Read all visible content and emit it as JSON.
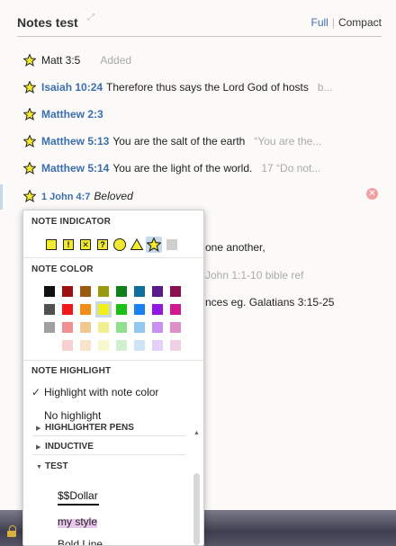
{
  "header": {
    "title": "Notes test",
    "view_full": "Full",
    "view_separator": "|",
    "view_compact": "Compact"
  },
  "notes": [
    {
      "ref": "Matt 3:5",
      "text": "",
      "extra": "Added"
    },
    {
      "ref": "Isaiah 10:24",
      "text": "Therefore thus says the Lord God of hosts",
      "extra": "b..."
    },
    {
      "ref": "Matthew 2:3",
      "text": "",
      "extra": ""
    },
    {
      "ref": "Matthew 5:13",
      "text": "You are the salt of the earth",
      "extra": "“You are the..."
    },
    {
      "ref": "Matthew 5:14",
      "text": "You are the light of the world.",
      "extra": "17 “Do not..."
    },
    {
      "ref": "1 John 4:7",
      "text": "Beloved",
      "extra": ""
    }
  ],
  "background_lines": [
    "one another,",
    "John 1:1-10 bible ref",
    "nces  eg.  Galatians 3:15-25"
  ],
  "popup": {
    "indicator_heading": "NOTE INDICATOR",
    "indicator_marks": [
      "!",
      "✕",
      "?"
    ],
    "color_heading": "NOTE COLOR",
    "colors": [
      [
        "#111111",
        "#9c1010",
        "#9a5a10",
        "#9a9a10",
        "#10801a",
        "#106e9c",
        "#5a1a8c",
        "#8c1050"
      ],
      [
        "#505050",
        "#f01818",
        "#f08c18",
        "#f0f018",
        "#18c018",
        "#1880f0",
        "#9018e0",
        "#d01890"
      ],
      [
        "#a0a0a0",
        "#f09090",
        "#f0c890",
        "#f0f090",
        "#90e090",
        "#90c8f0",
        "#c890f0",
        "#e090c8"
      ],
      [
        "",
        "#f8d0d0",
        "#f8e4cc",
        "#f8f8cc",
        "#d0f0d0",
        "#d0e4f8",
        "#e4d0f8",
        "#f0d0e4"
      ]
    ],
    "highlight_heading": "NOTE HIGHLIGHT",
    "highlight_options": [
      "Highlight with note color",
      "No highlight"
    ],
    "tree": [
      "HIGHLIGHTER PENS",
      "INDUCTIVE",
      "TEST"
    ],
    "styles": [
      "$$Dollar",
      "my style",
      "Bold Line"
    ]
  },
  "colors": {
    "accent": "#3b6fae",
    "indicator_fill": "#f3ea30",
    "selected_bg": "#c9d9ec"
  }
}
